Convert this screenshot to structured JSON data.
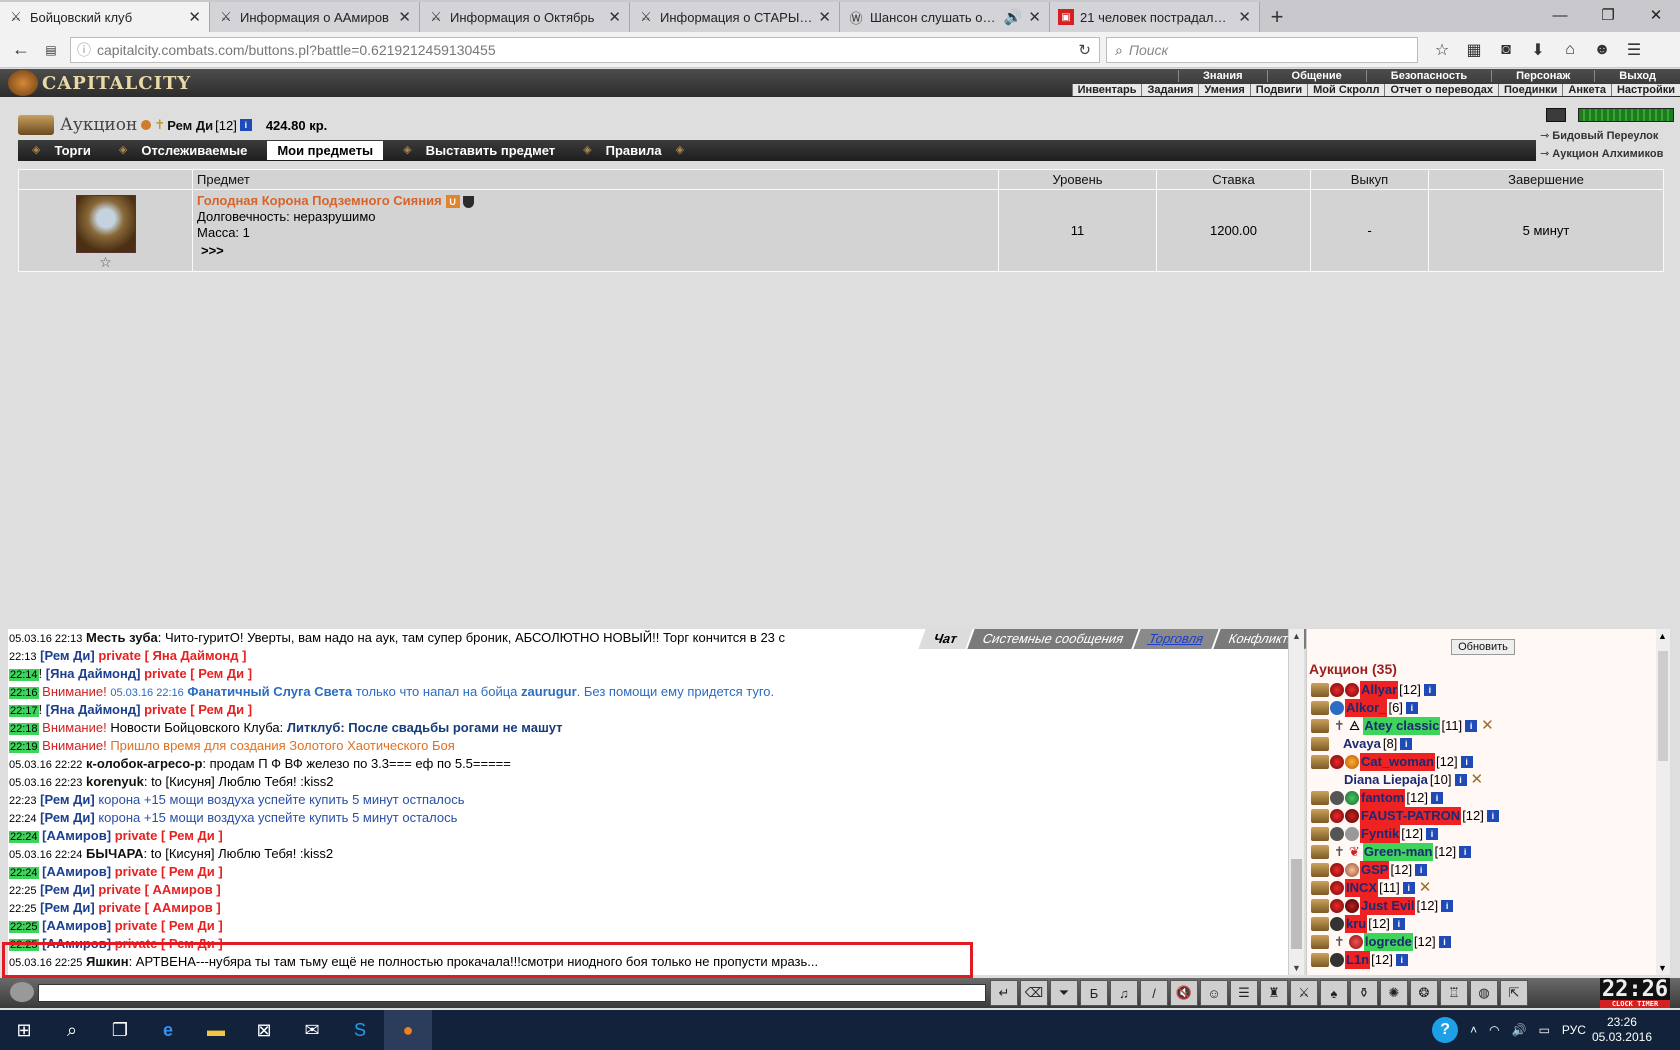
{
  "browser": {
    "tabs": [
      {
        "title": "Бойцовский клуб",
        "active": true
      },
      {
        "title": "Информация о ААмиров",
        "active": false
      },
      {
        "title": "Информация о Октябрь",
        "active": false
      },
      {
        "title": "Информация о СТАРЫЙ ...",
        "active": false
      },
      {
        "title": "Шансон слушать онл...",
        "active": false
      },
      {
        "title": "21 человек пострадали в ...",
        "active": false
      }
    ],
    "url": "capitalcity.combats.com/buttons.pl?battle=0.6219212459130455",
    "search_placeholder": "Поиск"
  },
  "game": {
    "logo": "CAPITALCITY",
    "top_menu": [
      "Знания",
      "Общение",
      "Безопасность",
      "Персонаж",
      "Выход"
    ],
    "sub_menu": [
      "Инвентарь",
      "Задания",
      "Умения",
      "Подвиги",
      "Мой Скролл",
      "Отчет о переводах",
      "Поединки",
      "Анкета",
      "Настройки"
    ]
  },
  "auction": {
    "title": "Аукцион",
    "user_name": "Рем Ди",
    "user_level": "[12]",
    "money": "424.80 кр.",
    "tabs": [
      "Торги",
      "Отслеживаемые",
      "Мои предметы",
      "Выставить предмет",
      "Правила"
    ],
    "active_tab": "Мои предметы",
    "right_links": [
      "Бидовый Переулок",
      "Аукцион Алхимиков"
    ],
    "table": {
      "headers": [
        "Предмет",
        "Уровень",
        "Ставка",
        "Выкуп",
        "Завершение"
      ],
      "rows": [
        {
          "name": "Голодная Корона Подземного Сияния",
          "durability": "Долговечность: неразрушимо",
          "mass": "Масса: 1",
          "more": ">>>",
          "level": "11",
          "bid": "1200.00",
          "buyout": "-",
          "ends": "5 минут"
        }
      ]
    }
  },
  "chat": {
    "tabs": [
      "Чат",
      "Системные сообщения",
      "Торговля",
      "Конфликты"
    ],
    "lines": [
      {
        "time": "05.03.16 22:13",
        "from": "Месть зуба",
        "text": ": Чито-гуритО! Уверты, вам надо на аук, там супер броник, АБСОЛЮТНО НОВЫЙ!! Торг кончится в 23 с"
      },
      {
        "time": "22:13",
        "from": "[Рем Ди]",
        "priv": "private [ Яна Даймонд ]",
        "text": ""
      },
      {
        "time": "22:14",
        "from": "[Яна Даймонд]",
        "priv": "private [ Рем Ди ]",
        "text": ""
      },
      {
        "time": "22:16",
        "warn": "Внимание!",
        "sub": "05.03.16 22:16",
        "boss": "Фанатичный Слуга Света",
        "text1": " только что напал на бойца ",
        "victim": "zaurugur",
        "text2": ". Без помощи ему придется туго."
      },
      {
        "time": "22:17",
        "from": "[Яна Даймонд]",
        "priv": "private [ Рем Ди ]",
        "text": ""
      },
      {
        "time": "22:18",
        "warn": "Внимание!",
        "text1": " Новости Бойцовского Клуба: ",
        "news": "Литклуб: После свадьбы рогами не машут"
      },
      {
        "time": "22:19",
        "warn": "Внимание!",
        "text1": " Пришло время для создания Золотого Хаотического Боя"
      },
      {
        "time": "05.03.16 22:22",
        "from": "к-олобок-агресо-р",
        "text": ": продам П Ф ВФ железо по 3.3=== еф по 5.5====="
      },
      {
        "time": "05.03.16 22:23",
        "from": "korenyuk",
        "text": ": to [Кисуня] Люблю Тебя! :kiss2"
      },
      {
        "time": "22:23",
        "from": "[Рем Ди]",
        "text": " корона +15 мощи воздуха успейте купить 5 минут остпалось"
      },
      {
        "time": "22:24",
        "from": "[Рем Ди]",
        "text": " корона +15 мощи воздуха успейте купить 5 минут осталось"
      },
      {
        "time": "22:24",
        "from": "[ААмиров]",
        "priv": "private [ Рем Ди ]",
        "text": ""
      },
      {
        "time": "05.03.16 22:24",
        "from": "БЫЧАРА",
        "text": ": to [Кисуня] Люблю Тебя! :kiss2"
      },
      {
        "time": "22:24",
        "from": "[ААмиров]",
        "priv": "private [ Рем Ди ]",
        "text": ""
      },
      {
        "time": "22:25",
        "from": "[Рем Ди]",
        "priv": "private [ ААмиров ]",
        "text": ""
      },
      {
        "time": "22:25",
        "from": "[Рем Ди]",
        "priv": "private [ ААмиров ]",
        "text": ""
      },
      {
        "time": "22:25",
        "from": "[ААмиров]",
        "priv": "private [ Рем Ди ]",
        "text": ""
      },
      {
        "time": "22:25",
        "from": "[ААмиров]",
        "priv": "private [ Рем Ди ]",
        "text": ""
      },
      {
        "time": "05.03.16 22:25",
        "from": "Яшкин",
        "text": ": АРТВЕНА---нубяра ты там тьму ещё не полностью прокачала!!!смотри ниодного боя только не пропусти мразь..."
      }
    ]
  },
  "online": {
    "refresh": "Обновить",
    "title": "Аукцион (35)",
    "users": [
      {
        "name": "Allyar",
        "level": "[12]",
        "style": "r",
        "x": false
      },
      {
        "name": "Alkor_",
        "level": "[6]",
        "style": "r",
        "x": false
      },
      {
        "name": "Atey classic",
        "level": "[11]",
        "style": "g",
        "x": true
      },
      {
        "name": "Avaya",
        "level": "[8]",
        "style": "n",
        "x": false
      },
      {
        "name": "Cat_woman",
        "level": "[12]",
        "style": "r",
        "x": false
      },
      {
        "name": "Diana Liepaja",
        "level": "[10]",
        "style": "n",
        "x": true
      },
      {
        "name": "fantom",
        "level": "[12]",
        "style": "r",
        "x": false
      },
      {
        "name": "FAUST-PATRON",
        "level": "[12]",
        "style": "r",
        "x": false
      },
      {
        "name": "Fyntik",
        "level": "[12]",
        "style": "r",
        "x": false
      },
      {
        "name": "Green-man",
        "level": "[12]",
        "style": "g",
        "x": false
      },
      {
        "name": "GSP",
        "level": "[12]",
        "style": "r",
        "x": false
      },
      {
        "name": "INCX",
        "level": "[11]",
        "style": "r",
        "x": true
      },
      {
        "name": "Just Evil",
        "level": "[12]",
        "style": "r",
        "x": false
      },
      {
        "name": "kru",
        "level": "[12]",
        "style": "r",
        "x": false
      },
      {
        "name": "logrede",
        "level": "[12]",
        "style": "g",
        "x": false
      },
      {
        "name": "L1n",
        "level": "[12]",
        "style": "r",
        "x": false
      }
    ]
  },
  "bottom": {
    "clock": "22:26",
    "clock_label": "CLOCK TIMER"
  },
  "taskbar": {
    "lang": "РУС",
    "time": "23:26",
    "date": "05.03.2016"
  }
}
